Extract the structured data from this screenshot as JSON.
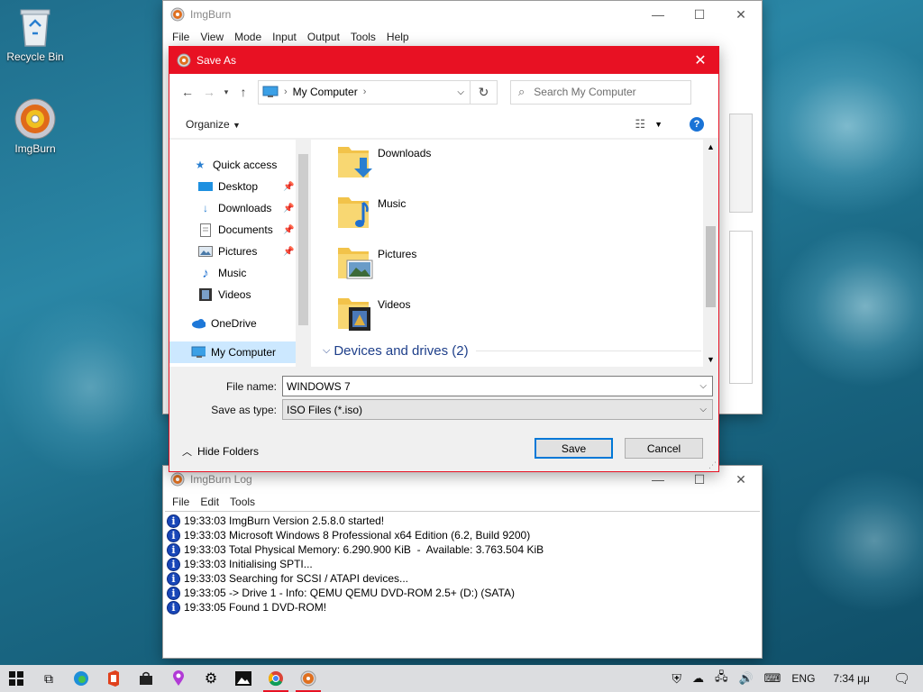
{
  "desktop": {
    "icons": [
      {
        "label": "Recycle Bin"
      },
      {
        "label": "ImgBurn"
      }
    ]
  },
  "imgburn_main": {
    "title": "ImgBurn",
    "menu": [
      "File",
      "View",
      "Mode",
      "Input",
      "Output",
      "Tools",
      "Help"
    ]
  },
  "save_dialog": {
    "title": "Save As",
    "address": {
      "location": "My Computer"
    },
    "search": {
      "placeholder": "Search My Computer"
    },
    "toolbar": {
      "organize": "Organize",
      "help": "?"
    },
    "nav": [
      {
        "label": "Quick access",
        "icon": "star-icon"
      },
      {
        "label": "Desktop",
        "icon": "desktop-folder-icon",
        "pinned": true
      },
      {
        "label": "Downloads",
        "icon": "downloads-arrow-icon",
        "pinned": true
      },
      {
        "label": "Documents",
        "icon": "document-icon",
        "pinned": true
      },
      {
        "label": "Pictures",
        "icon": "pictures-icon",
        "pinned": true
      },
      {
        "label": "Music",
        "icon": "music-note-icon"
      },
      {
        "label": "Videos",
        "icon": "film-icon"
      },
      {
        "label": "OneDrive",
        "icon": "cloud-icon"
      },
      {
        "label": "My Computer",
        "icon": "computer-icon",
        "selected": true
      }
    ],
    "folders": [
      {
        "name": "Downloads"
      },
      {
        "name": "Music"
      },
      {
        "name": "Pictures"
      },
      {
        "name": "Videos"
      }
    ],
    "group_header": "Devices and drives (2)",
    "file_name_label": "File name:",
    "file_name_value": "WINDOWS 7",
    "save_type_label": "Save as type:",
    "save_type_value": "ISO Files (*.iso)",
    "hide_folders": "Hide Folders",
    "save_button": "Save",
    "cancel_button": "Cancel",
    "accent_color": "#e81123"
  },
  "imgburn_log": {
    "title": "ImgBurn Log",
    "menu": [
      "File",
      "Edit",
      "Tools"
    ],
    "lines": [
      "19:33:03 ImgBurn Version 2.5.8.0 started!",
      "19:33:03 Microsoft Windows 8 Professional x64 Edition (6.2, Build 9200)",
      "19:33:03 Total Physical Memory: 6.290.900 KiB  -  Available: 3.763.504 KiB",
      "19:33:03 Initialising SPTI...",
      "19:33:03 Searching for SCSI / ATAPI devices...",
      "19:33:05 -> Drive 1 - Info: QEMU QEMU DVD-ROM 2.5+ (D:) (SATA)",
      "19:33:05 Found 1 DVD-ROM!"
    ]
  },
  "taskbar": {
    "language": "ENG",
    "clock": "7:34 μμ"
  }
}
